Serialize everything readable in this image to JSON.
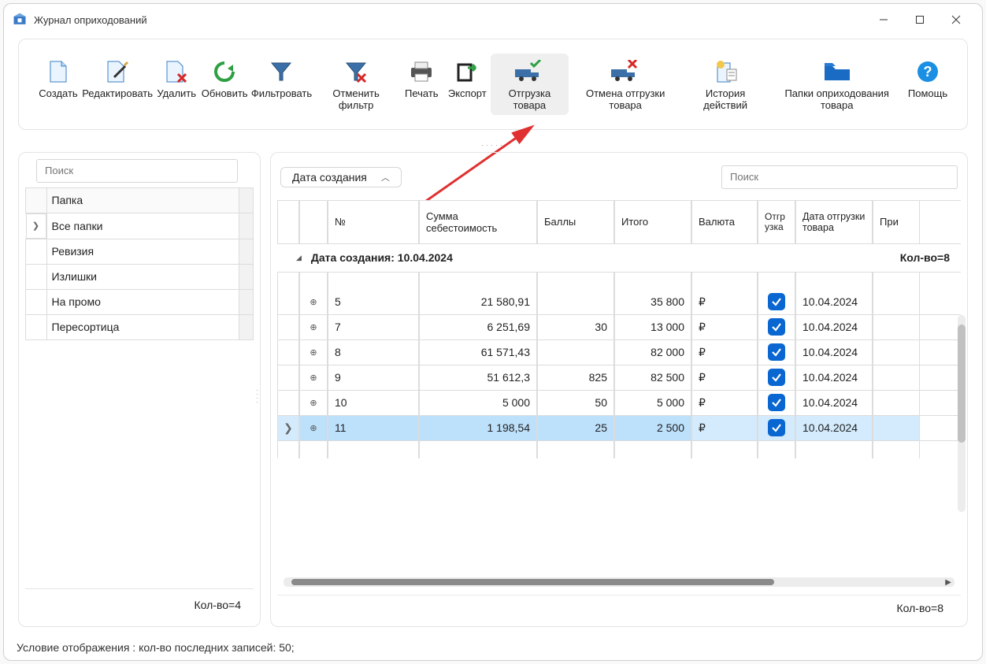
{
  "window": {
    "title": "Журнал оприходований"
  },
  "toolbar": {
    "create": "Создать",
    "edit": "Редактировать",
    "delete": "Удалить",
    "refresh": "Обновить",
    "filter": "Фильтровать",
    "cancel_filter": "Отменить фильтр",
    "print": "Печать",
    "export": "Экспорт",
    "ship": "Отгрузка товара",
    "cancel_ship": "Отмена отгрузки товара",
    "history": "История действий",
    "folders": "Папки оприходования товара",
    "help": "Помощь"
  },
  "sidebar": {
    "search_placeholder": "Поиск",
    "header": "Папка",
    "items": [
      "Все папки",
      "Ревизия",
      "Излишки",
      "На промо",
      "Пересортица"
    ],
    "footer": "Кол-во=4"
  },
  "grid": {
    "date_chip": "Дата создания",
    "search_placeholder": "Поиск",
    "columns": {
      "num": "№",
      "cost": "Сумма себестоимость",
      "points": "Баллы",
      "total": "Итого",
      "currency": "Валюта",
      "ship": "Отгр узка",
      "ship_date": "Дата отгрузки товара",
      "note": "При"
    },
    "group_label": "Дата создания: 10.04.2024",
    "group_count": "Кол-во=8",
    "rows": [
      {
        "num": "5",
        "cost": "21 580,91",
        "points": "",
        "total": "35 800",
        "currency": "₽",
        "ship": true,
        "ship_date": "10.04.2024"
      },
      {
        "num": "7",
        "cost": "6 251,69",
        "points": "30",
        "total": "13 000",
        "currency": "₽",
        "ship": true,
        "ship_date": "10.04.2024"
      },
      {
        "num": "8",
        "cost": "61 571,43",
        "points": "",
        "total": "82 000",
        "currency": "₽",
        "ship": true,
        "ship_date": "10.04.2024"
      },
      {
        "num": "9",
        "cost": "51 612,3",
        "points": "825",
        "total": "82 500",
        "currency": "₽",
        "ship": true,
        "ship_date": "10.04.2024"
      },
      {
        "num": "10",
        "cost": "5 000",
        "points": "50",
        "total": "5 000",
        "currency": "₽",
        "ship": true,
        "ship_date": "10.04.2024"
      },
      {
        "num": "11",
        "cost": "1 198,54",
        "points": "25",
        "total": "2 500",
        "currency": "₽",
        "ship": true,
        "ship_date": "10.04.2024",
        "selected": true
      }
    ],
    "footer": "Кол-во=8"
  },
  "status": "Условие отображения  :  кол-во последних записей: 50;"
}
